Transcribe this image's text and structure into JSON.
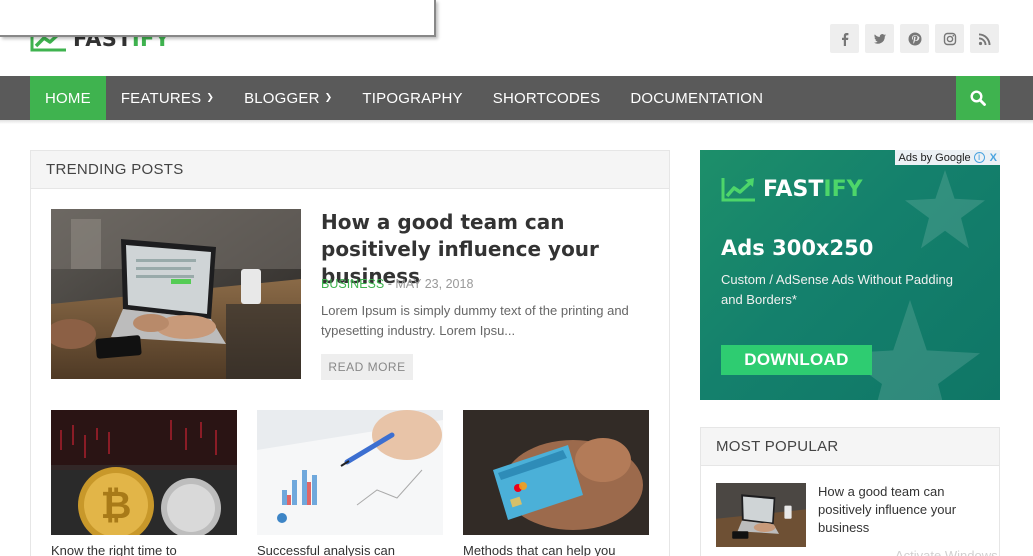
{
  "header": {
    "logo": {
      "part1": "FAST",
      "part2": "IFY"
    },
    "socials": [
      {
        "icon": "facebook-icon",
        "glyph": "f"
      },
      {
        "icon": "twitter-icon",
        "glyph": "t"
      },
      {
        "icon": "pinterest-icon",
        "glyph": "p"
      },
      {
        "icon": "instagram-icon",
        "glyph": "ig"
      },
      {
        "icon": "rss-icon",
        "glyph": "rss"
      }
    ]
  },
  "nav": {
    "items": [
      {
        "label": "HOME",
        "active": true,
        "dropdown": false
      },
      {
        "label": "FEATURES",
        "active": false,
        "dropdown": true
      },
      {
        "label": "BLOGGER",
        "active": false,
        "dropdown": true
      },
      {
        "label": "TIPOGRAPHY",
        "active": false,
        "dropdown": false
      },
      {
        "label": "SHORTCODES",
        "active": false,
        "dropdown": false
      },
      {
        "label": "DOCUMENTATION",
        "active": false,
        "dropdown": false
      }
    ],
    "search_icon": "search-icon"
  },
  "trending": {
    "heading": "TRENDING POSTS",
    "featured": {
      "title": "How a good team can positively influence your business",
      "category": "BUSINESS",
      "separator": " - ",
      "date": "MAY 23, 2018",
      "excerpt": "Lorem Ipsum is simply dummy text of the printing and typesetting industry. Lorem Ipsu...",
      "read_more": "READ MORE"
    },
    "cards": [
      {
        "title": "Know the right time to"
      },
      {
        "title": "Successful analysis can"
      },
      {
        "title": "Methods that can help you"
      }
    ]
  },
  "ad": {
    "ads_by": "Ads by Google",
    "info_glyph": "i",
    "close_glyph": "X",
    "logo": {
      "part1": "FAST",
      "part2": "IFY"
    },
    "headline": "Ads 300x250",
    "subtext": "Custom / AdSense Ads Without Padding and Borders*",
    "button": "DOWNLOAD"
  },
  "popular": {
    "heading": "MOST POPULAR",
    "items": [
      {
        "title": "How a good team can positively influence your business"
      }
    ]
  },
  "watermark": "Activate Windows",
  "colors": {
    "accent": "#3fb34f",
    "nav": "#5a5a5a",
    "ad_bg": "#14806c"
  }
}
